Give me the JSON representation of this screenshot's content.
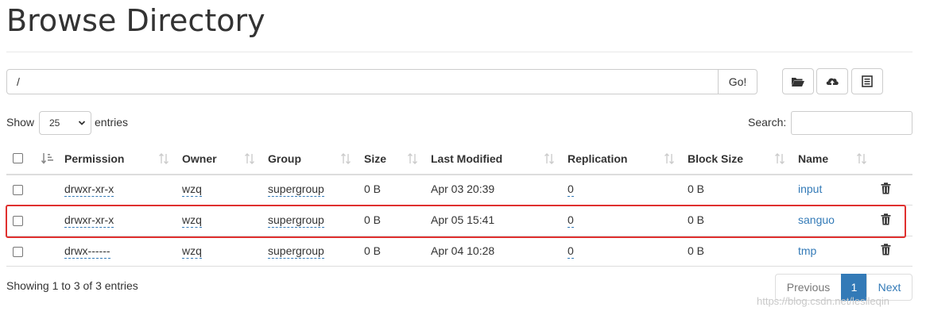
{
  "page": {
    "title": "Browse Directory"
  },
  "toolbar": {
    "path_value": "/",
    "go_label": "Go!",
    "icons": [
      "folder-open-icon",
      "upload-cloud-icon",
      "list-icon"
    ]
  },
  "controls": {
    "show_label": "Show",
    "entries_value": "25",
    "entries_label": "entries",
    "search_label": "Search:",
    "search_value": ""
  },
  "table": {
    "headers": {
      "permission": "Permission",
      "owner": "Owner",
      "group": "Group",
      "size": "Size",
      "last_modified": "Last Modified",
      "replication": "Replication",
      "block_size": "Block Size",
      "name": "Name"
    },
    "rows": [
      {
        "permission": "drwxr-xr-x",
        "owner": "wzq",
        "group": "supergroup",
        "size": "0 B",
        "last_modified": "Apr 03 20:39",
        "replication": "0",
        "block_size": "0 B",
        "name": "input"
      },
      {
        "permission": "drwxr-xr-x",
        "owner": "wzq",
        "group": "supergroup",
        "size": "0 B",
        "last_modified": "Apr 05 15:41",
        "replication": "0",
        "block_size": "0 B",
        "name": "sanguo",
        "highlighted": true
      },
      {
        "permission": "drwx------",
        "owner": "wzq",
        "group": "supergroup",
        "size": "0 B",
        "last_modified": "Apr 04 10:28",
        "replication": "0",
        "block_size": "0 B",
        "name": "tmp"
      }
    ]
  },
  "footer": {
    "info": "Showing 1 to 3 of 3 entries",
    "previous": "Previous",
    "page": "1",
    "next": "Next",
    "watermark": "https://blog.csdn.net/lesileqin"
  },
  "colors": {
    "link": "#337ab7",
    "highlight_border": "#e0302e",
    "active_page": "#337ab7"
  }
}
